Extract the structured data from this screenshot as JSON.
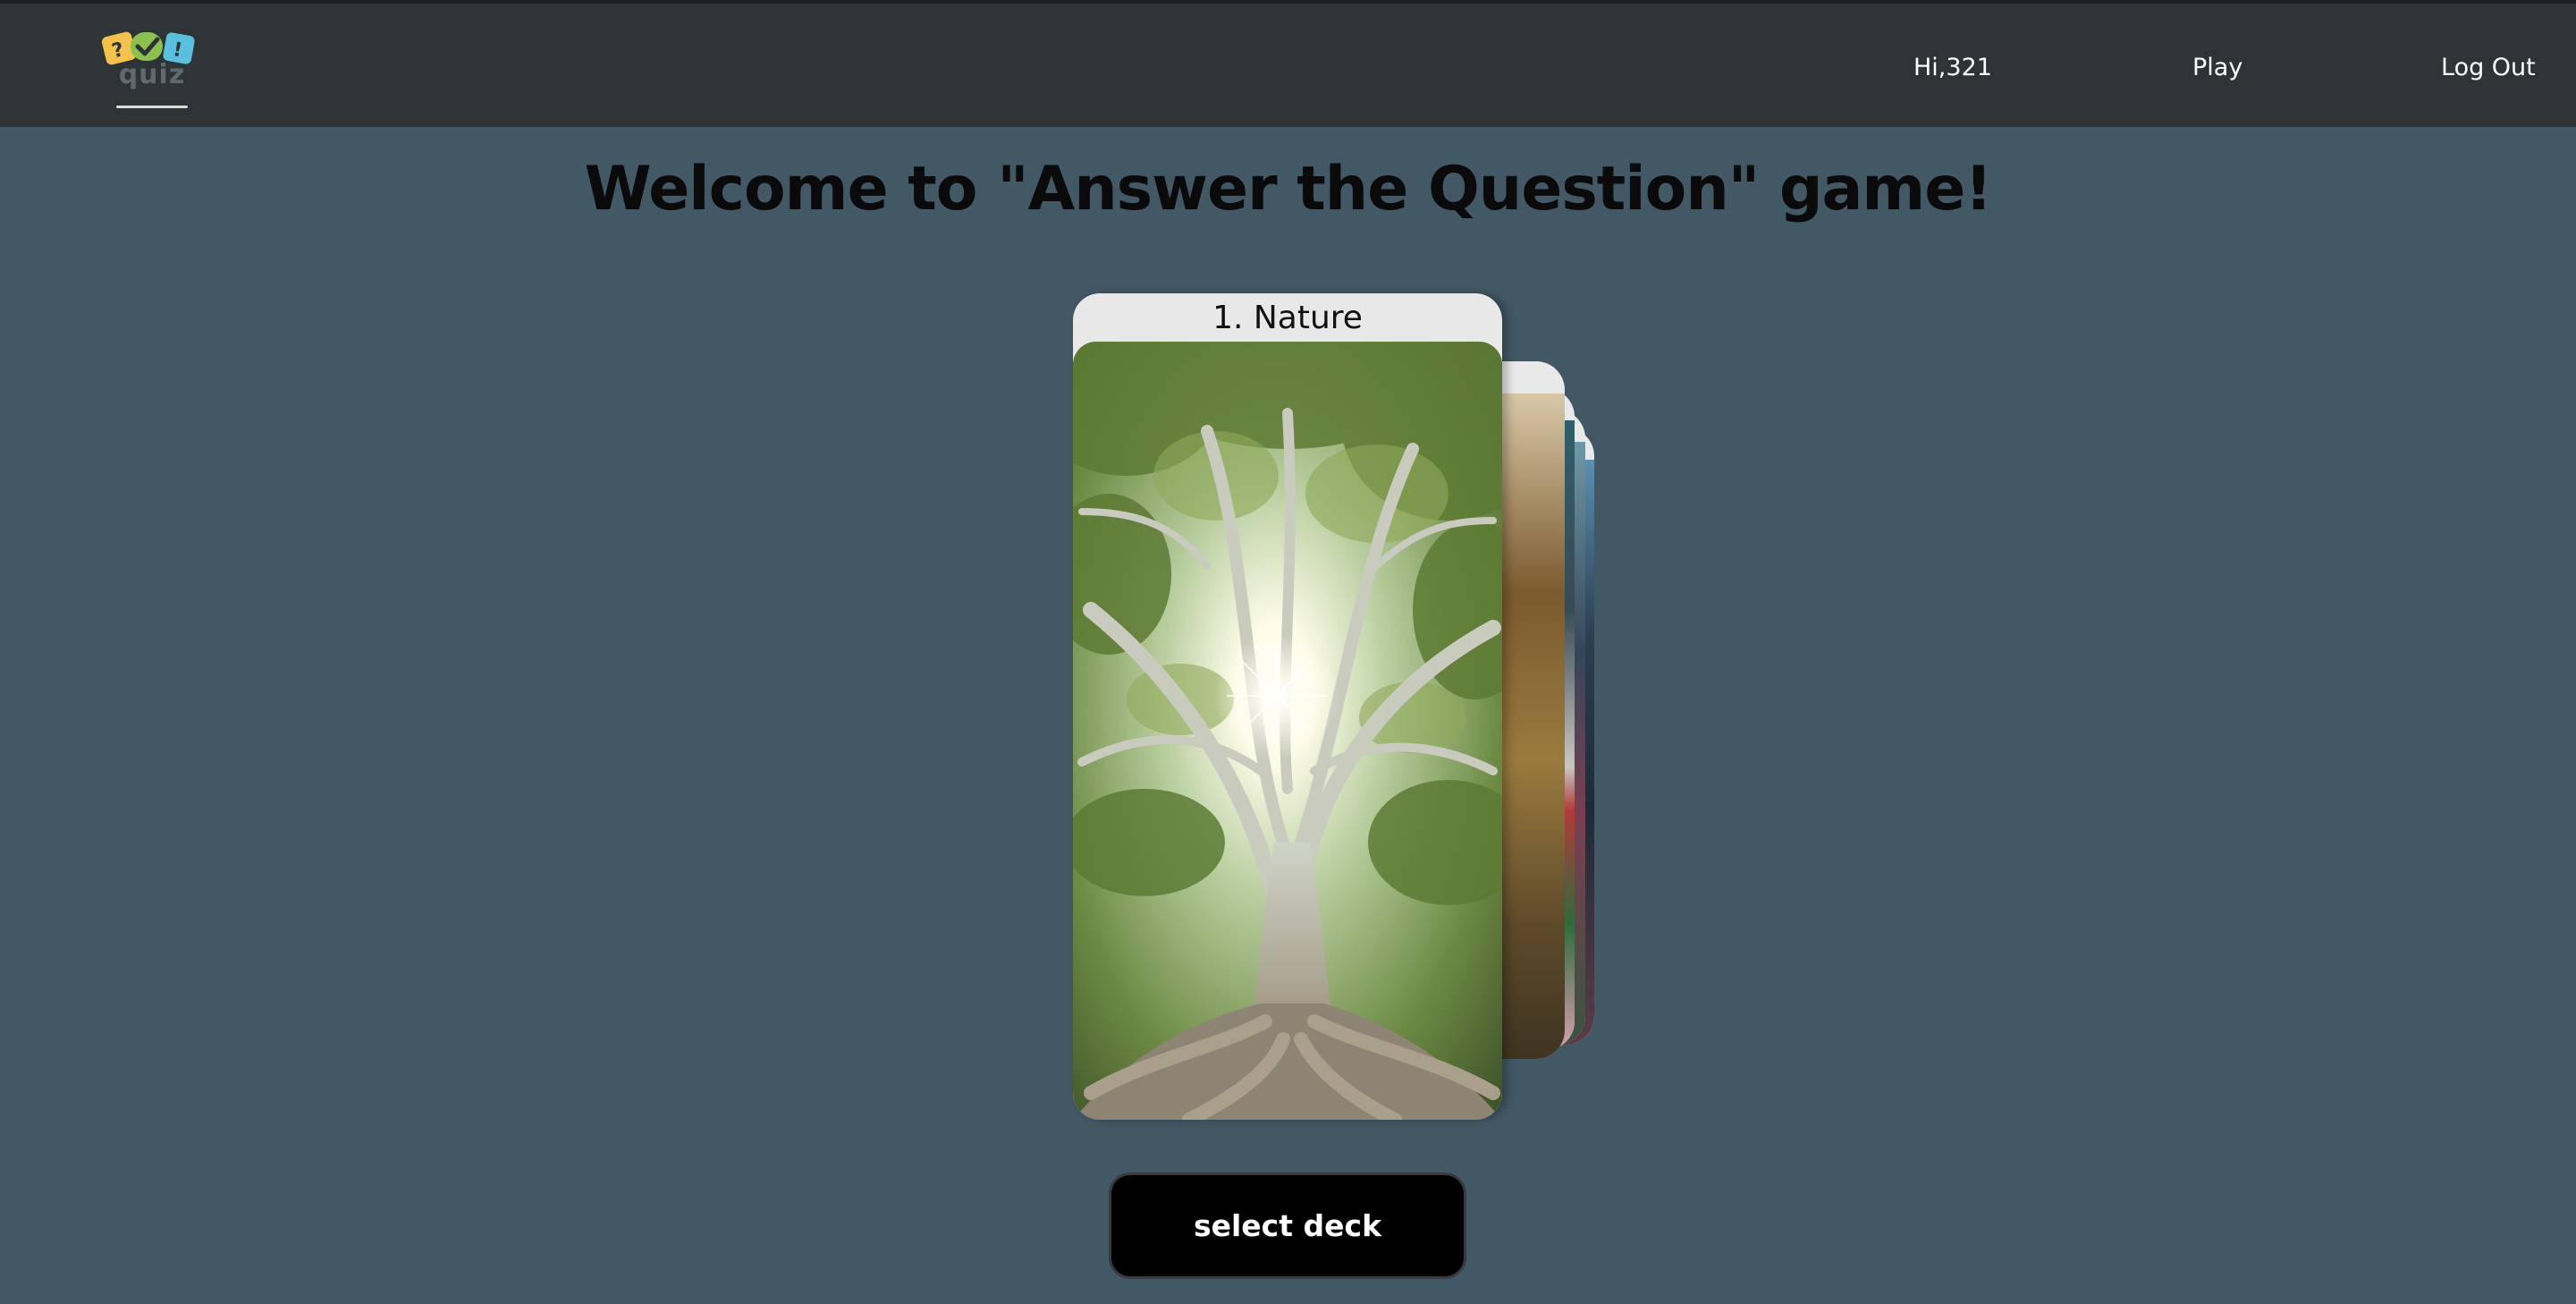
{
  "header": {
    "logo_word": "quiz",
    "greeting": "Hi,321",
    "nav": {
      "play_label": "Play",
      "logout_label": "Log Out"
    }
  },
  "main": {
    "title": "Welcome to \"Answer the Question\" game!",
    "active_deck": {
      "title": "1. Nature"
    },
    "select_button_label": "select deck"
  },
  "colors": {
    "page_background": "#425864",
    "header_background": "#2e3335",
    "button_background": "#000000",
    "card_background": "#e8e8e8"
  }
}
